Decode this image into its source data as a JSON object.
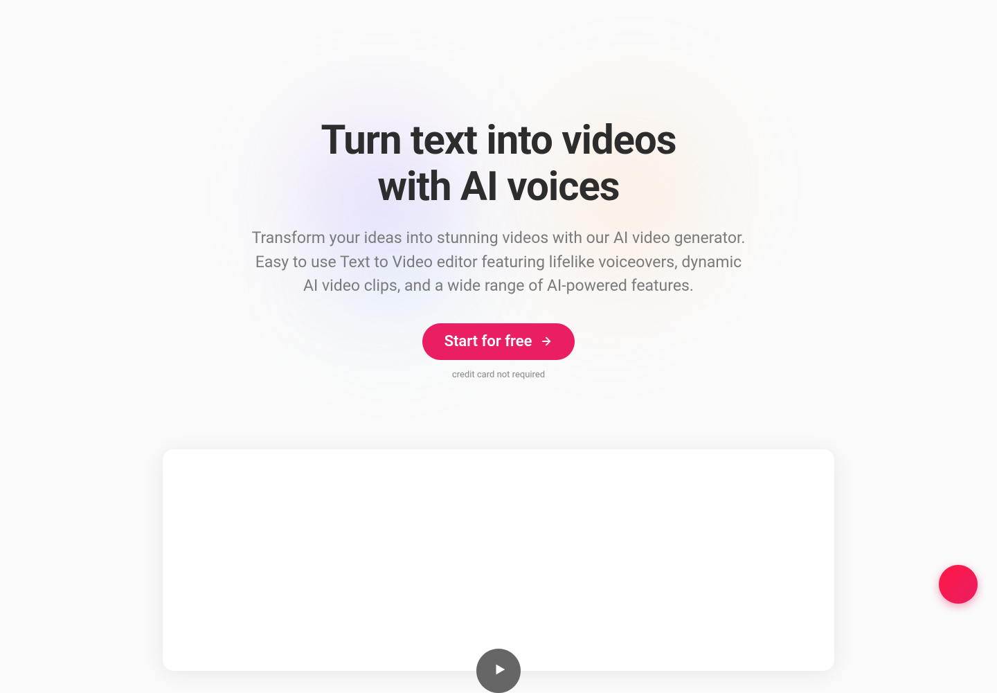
{
  "hero": {
    "headline_line1": "Turn text into videos",
    "headline_line2": "with AI voices",
    "subheadline": "Transform your ideas into stunning videos with our AI video generator. Easy to use Text to Video editor featuring lifelike voiceovers, dynamic AI video clips, and a wide range of AI-powered features.",
    "cta_label": "Start for free",
    "fine_print": "credit card not required"
  },
  "colors": {
    "cta_bg": "#e91e63",
    "text_dark": "#2d2d2d",
    "text_muted": "#7a7a7a"
  }
}
